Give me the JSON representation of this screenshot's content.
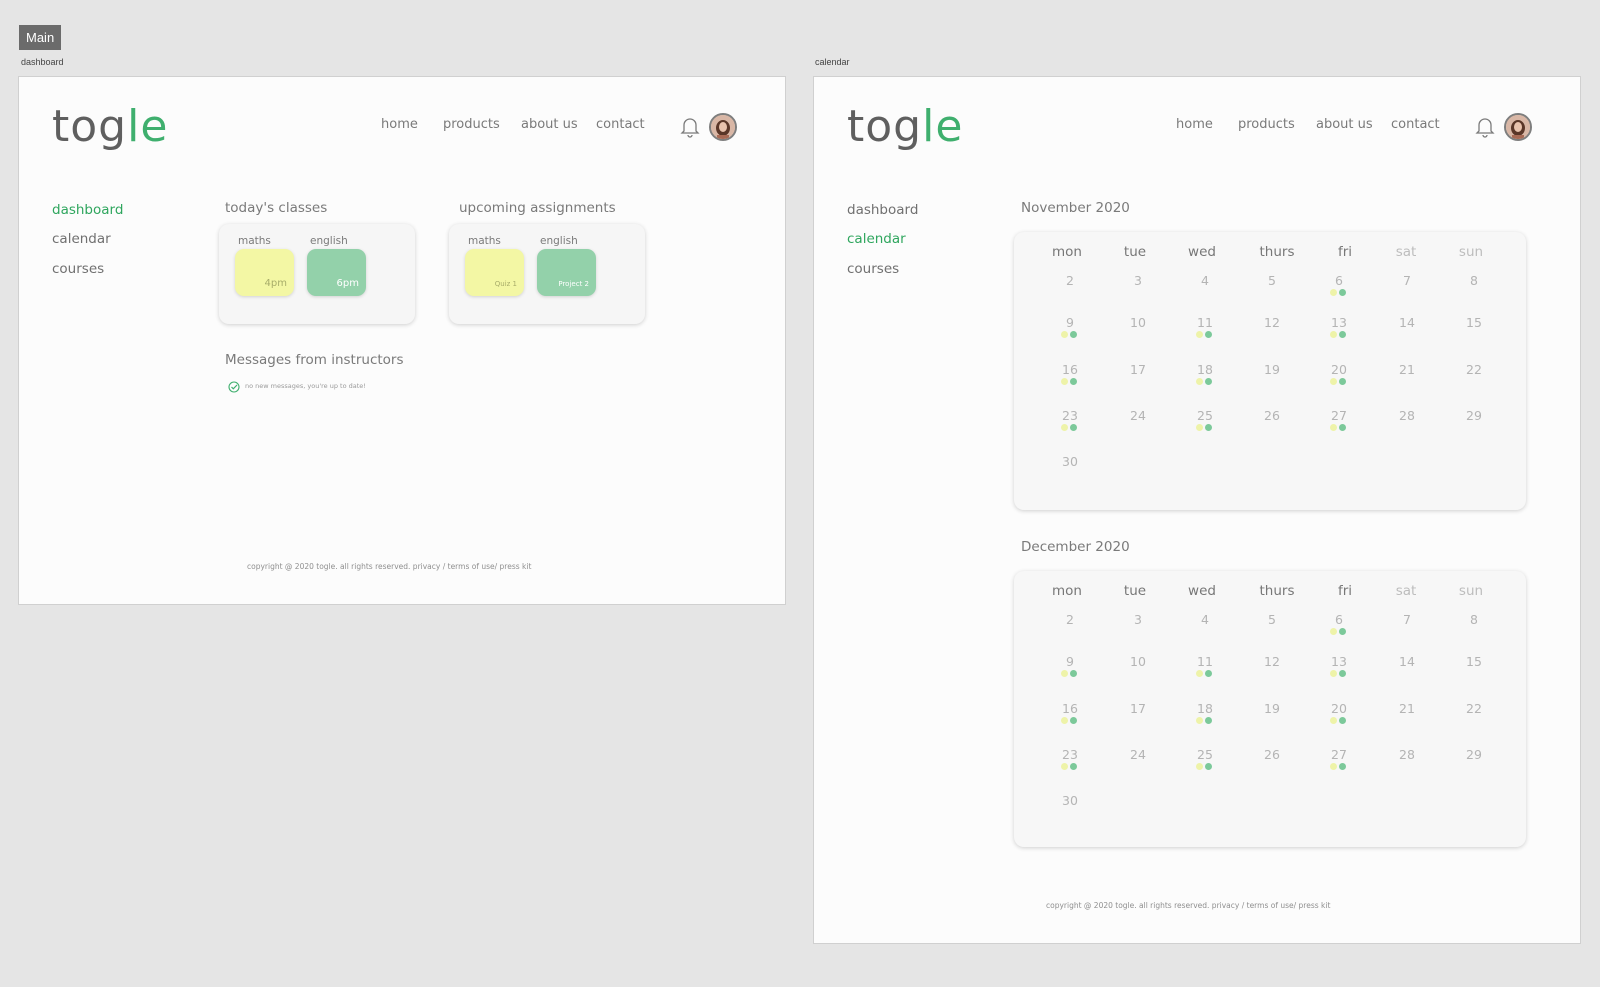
{
  "page_tag": "Main",
  "frames": {
    "dashboard_label": "dashboard",
    "calendar_label": "calendar"
  },
  "brand": {
    "logo_main": "tog",
    "logo_accent": "le",
    "accent_color": "#3faf6e"
  },
  "topnav": [
    "home",
    "products",
    "about us",
    "contact"
  ],
  "sidenav": [
    "dashboard",
    "calendar",
    "courses"
  ],
  "dashboard": {
    "todays_classes": {
      "title": "today's classes",
      "items": [
        {
          "label": "maths",
          "value": "4pm",
          "color": "yellow"
        },
        {
          "label": "english",
          "value": "6pm",
          "color": "green"
        }
      ]
    },
    "upcoming_assignments": {
      "title": "upcoming assignments",
      "items": [
        {
          "label": "maths",
          "value": "Quiz 1",
          "color": "yellow"
        },
        {
          "label": "english",
          "value": "Project 2",
          "color": "green"
        }
      ]
    },
    "messages": {
      "title": "Messages from instructors",
      "status": "no new messages, you're up to date!"
    }
  },
  "footer": "copyright @ 2020 togle. all rights reserved. privacy / terms of use/ press kit",
  "calendar": {
    "weekdays": [
      "mon",
      "tue",
      "wed",
      "thurs",
      "fri",
      "sat",
      "sun"
    ],
    "months": [
      {
        "title": "November 2020",
        "weeks": [
          [
            "2",
            "3",
            "4",
            "5",
            "6",
            "7",
            "8"
          ],
          [
            "9",
            "10",
            "11",
            "12",
            "13",
            "14",
            "15"
          ],
          [
            "16",
            "17",
            "18",
            "19",
            "20",
            "21",
            "22"
          ],
          [
            "23",
            "24",
            "25",
            "26",
            "27",
            "28",
            "29"
          ],
          [
            "30"
          ]
        ],
        "event_days": [
          "6",
          "9",
          "11",
          "13",
          "16",
          "18",
          "20",
          "23",
          "25",
          "27"
        ]
      },
      {
        "title": "December 2020",
        "weeks": [
          [
            "2",
            "3",
            "4",
            "5",
            "6",
            "7",
            "8"
          ],
          [
            "9",
            "10",
            "11",
            "12",
            "13",
            "14",
            "15"
          ],
          [
            "16",
            "17",
            "18",
            "19",
            "20",
            "21",
            "22"
          ],
          [
            "23",
            "24",
            "25",
            "26",
            "27",
            "28",
            "29"
          ],
          [
            "30"
          ]
        ],
        "event_days": [
          "6",
          "9",
          "11",
          "13",
          "16",
          "18",
          "20",
          "23",
          "25",
          "27"
        ]
      }
    ]
  }
}
